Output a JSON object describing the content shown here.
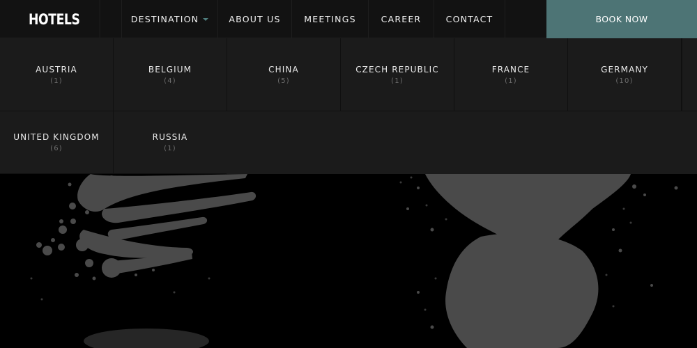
{
  "brand": {
    "logo_text": "HOTELS"
  },
  "nav": {
    "items": [
      {
        "label": "DESTINATION",
        "has_dropdown": true
      },
      {
        "label": "ABOUT US"
      },
      {
        "label": "MEETINGS"
      },
      {
        "label": "CAREER"
      },
      {
        "label": "CONTACT"
      }
    ],
    "book_label": "BOOK NOW"
  },
  "destinations": [
    {
      "name": "AUSTRIA",
      "count": "(1)"
    },
    {
      "name": "BELGIUM",
      "count": "(4)"
    },
    {
      "name": "CHINA",
      "count": "(5)"
    },
    {
      "name": "CZECH REPUBLIC",
      "count": "(1)"
    },
    {
      "name": "FRANCE",
      "count": "(1)"
    },
    {
      "name": "GERMANY",
      "count": "(10)"
    },
    {
      "name": "UNITED KINGDOM",
      "count": "(6)"
    },
    {
      "name": "RUSSIA",
      "count": "(1)"
    }
  ],
  "colors": {
    "accent": "#4d7475",
    "nav_bg": "#121212",
    "dropdown_bg": "#1b1b1b",
    "splatter": "#4a4a4a"
  }
}
